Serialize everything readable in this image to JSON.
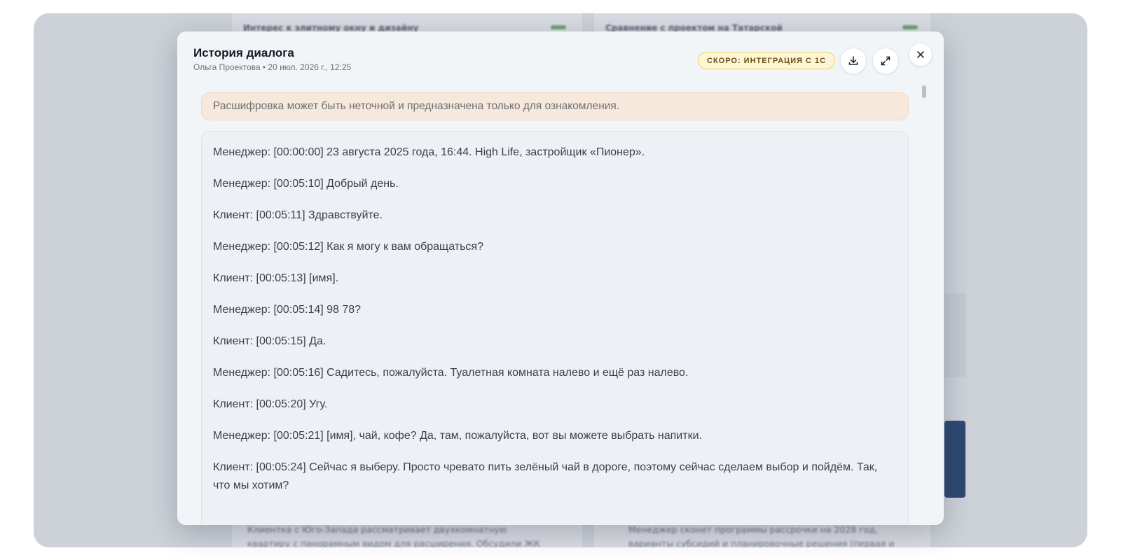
{
  "background": {
    "left_card_header": "Интерес к элитному окну и дизайну",
    "right_card_header": "Сравнение с проектом на Татарской",
    "left_footer": "Клиентка с Юго-Запада рассматривает двухкомнатную квартиру с панорамным видом для расширения. Обсудили ЖК Primavera.",
    "right_footer": "Менеджер сконет программы рассрочки на 2028 год, варианты субсидий и планировочные решения (первая и"
  },
  "modal": {
    "title": "История диалога",
    "subtitle": "Ольга Проектова • 20 июл. 2026 г., 12:25",
    "badge": "СКОРО: ИНТЕГРАЦИЯ С 1С",
    "notice": "Расшифровка может быть неточной и предназначена только для ознакомления.",
    "icons": {
      "download": "download-icon",
      "expand": "expand-icon",
      "close": "close-icon"
    },
    "transcript": [
      "Менеджер: [00:00:00] 23 августа 2025 года, 16:44. High Life, застройщик «Пионер».",
      "Менеджер: [00:05:10] Добрый день.",
      "Клиент: [00:05:11] Здравствуйте.",
      "Менеджер: [00:05:12] Как я могу к вам обращаться?",
      "Клиент: [00:05:13] [имя].",
      "Менеджер: [00:05:14] 98 78?",
      "Клиент: [00:05:15] Да.",
      "Менеджер: [00:05:16] Садитесь, пожалуйста. Туалетная комната налево и ещё раз налево.",
      "Клиент: [00:05:20] Угу.",
      "Менеджер: [00:05:21] [имя], чай, кофе? Да, там, пожалуйста, вот вы можете выбрать напитки.",
      "Клиент: [00:05:24] Сейчас я выберу. Просто чревато пить зелёный чай в дороге, поэтому сейчас сделаем выбор и пойдём. Так, что мы хотим?"
    ]
  }
}
